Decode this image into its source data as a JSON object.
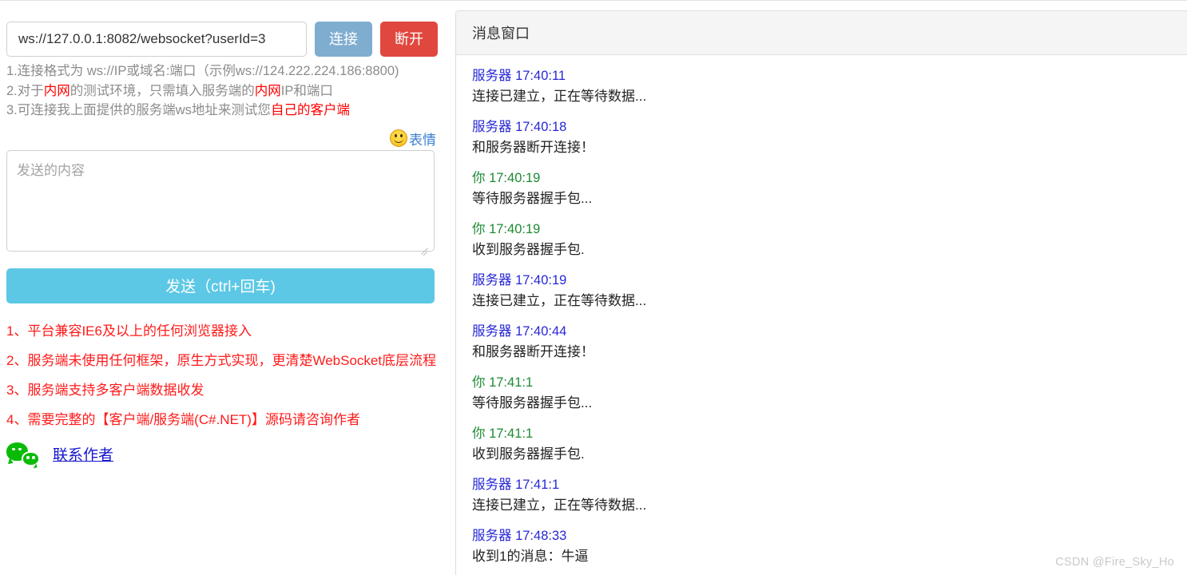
{
  "connection": {
    "url_value": "ws://127.0.0.1:8082/websocket?userId=3",
    "url_placeholder": "ws://IP或域名:端口",
    "connect_label": "连接",
    "disconnect_label": "断开"
  },
  "tips": [
    {
      "prefix": "1.连接格式为 ws://IP或域名:端口（示例ws://124.222.224.186:8800)",
      "highlight": "",
      "suffix": ""
    },
    {
      "prefix": "2.对于",
      "highlight": "内网",
      "mid": "的测试环境，只需填入服务端的",
      "highlight2": "内网",
      "suffix": "IP和端口"
    },
    {
      "prefix": "3.可连接我上面提供的服务端ws地址来测试您",
      "highlight": "自己的客户端",
      "suffix": ""
    }
  ],
  "emoji": {
    "icon": "smiley-face-icon",
    "label": "表情"
  },
  "compose": {
    "placeholder": "发送的内容",
    "value": "",
    "send_label": "发送（ctrl+回车)"
  },
  "features": [
    "1、平台兼容IE6及以上的任何浏览器接入",
    "2、服务端未使用任何框架，原生方式实现，更清楚WebSocket底层流程",
    "3、服务端支持多客户端数据收发",
    "4、需要完整的【客户端/服务端(C#.NET)】源码请咨询作者"
  ],
  "author": {
    "icon": "wechat-icon",
    "link_label": "联系作者"
  },
  "message_window": {
    "title": "消息窗口",
    "messages": [
      {
        "sender": "服务器",
        "time": "17:40:11",
        "type": "server",
        "text": "连接已建立，正在等待数据..."
      },
      {
        "sender": "服务器",
        "time": "17:40:18",
        "type": "server",
        "text": "和服务器断开连接！"
      },
      {
        "sender": "你",
        "time": "17:40:19",
        "type": "you",
        "text": "等待服务器握手包..."
      },
      {
        "sender": "你",
        "time": "17:40:19",
        "type": "you",
        "text": "收到服务器握手包."
      },
      {
        "sender": "服务器",
        "time": "17:40:19",
        "type": "server",
        "text": "连接已建立，正在等待数据..."
      },
      {
        "sender": "服务器",
        "time": "17:40:44",
        "type": "server",
        "text": "和服务器断开连接！"
      },
      {
        "sender": "你",
        "time": "17:41:1",
        "type": "you",
        "text": "等待服务器握手包..."
      },
      {
        "sender": "你",
        "time": "17:41:1",
        "type": "you",
        "text": "收到服务器握手包."
      },
      {
        "sender": "服务器",
        "time": "17:41:1",
        "type": "server",
        "text": "连接已建立，正在等待数据..."
      },
      {
        "sender": "服务器",
        "time": "17:48:33",
        "type": "server",
        "text": "收到1的消息：牛逼"
      }
    ]
  },
  "watermark": "CSDN @Fire_Sky_Ho",
  "colors": {
    "connect_button": "#7fadd0",
    "disconnect_button": "#e0483f",
    "send_button": "#5cc8e5",
    "server_label": "#2727d6",
    "you_label": "#1d8a33",
    "feature_text": "#ff1a1a",
    "link": "#1515cd",
    "wechat_green": "#09bb07"
  }
}
